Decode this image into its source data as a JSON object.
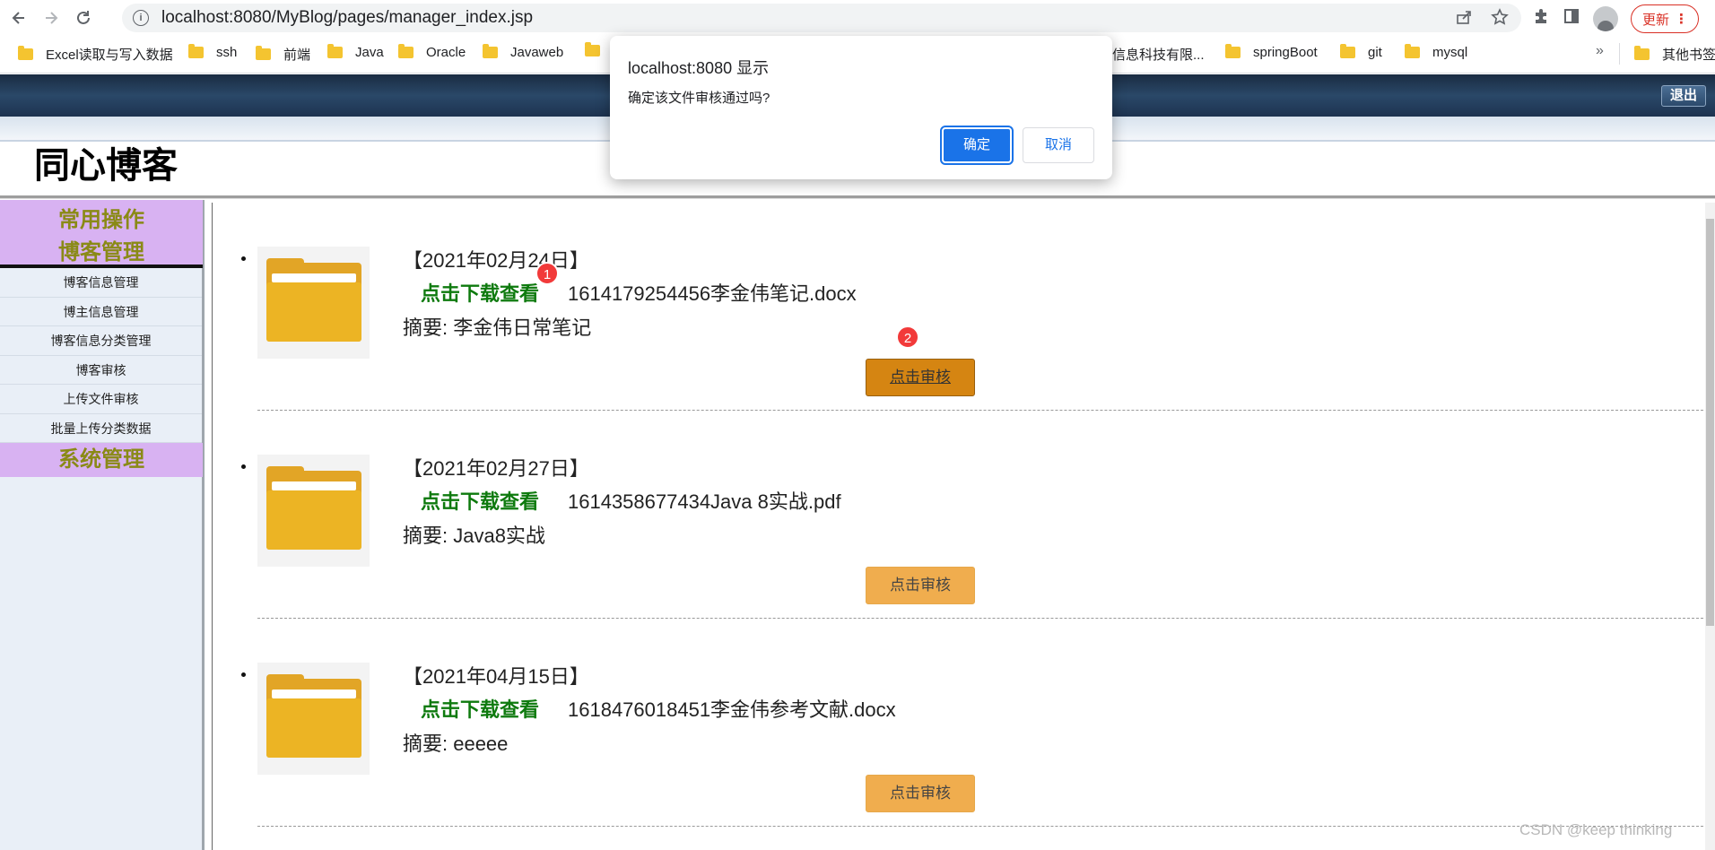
{
  "browser": {
    "url": "localhost:8080/MyBlog/pages/manager_index.jsp",
    "update_label": "更新",
    "more_bookmarks": "»",
    "bookmarks": [
      "Excel读取与写入数据",
      "ssh",
      "前端",
      "Java",
      "Oracle",
      "Javaweb",
      "",
      "信息科技有限...",
      "springBoot",
      "git",
      "mysql"
    ],
    "other_bookmarks": "其他书签"
  },
  "header": {
    "logout_label": "退出",
    "site_title": "同心博客"
  },
  "sidebar": {
    "section1": "常用操作",
    "section2": "博客管理",
    "items": [
      "博客信息管理",
      "博主信息管理",
      "博客信息分类管理",
      "博客审核",
      "上传文件审核",
      "批量上传分类数据"
    ],
    "section3": "系统管理"
  },
  "entries": [
    {
      "date": "【2021年02月24日】",
      "download_label": "点击下载查看",
      "filename": "1614179254456李金伟笔记.docx",
      "summary": "摘要: 李金伟日常笔记",
      "review_label": "点击审核"
    },
    {
      "date": "【2021年02月27日】",
      "download_label": "点击下载查看",
      "filename": "1614358677434Java 8实战.pdf",
      "summary": "摘要: Java8实战",
      "review_label": "点击审核"
    },
    {
      "date": "【2021年04月15日】",
      "download_label": "点击下载查看",
      "filename": "1618476018451李金伟参考文献.docx",
      "summary": "摘要: eeeee",
      "review_label": "点击审核"
    }
  ],
  "annotations": {
    "badge1": "1",
    "badge2": "2"
  },
  "dialog": {
    "title": "localhost:8080 显示",
    "message": "确定该文件审核通过吗?",
    "ok_label": "确定",
    "cancel_label": "取消"
  },
  "watermark": "CSDN @keep   thinking",
  "colors": {
    "header_dark": "#1a2c42",
    "sidebar_head": "#d8b2f2",
    "sidebar_head_text": "#8a8a16",
    "link_green": "#0e7a0e",
    "review_button": "#f0ad4e",
    "review_button_active": "#d58512",
    "dialog_primary": "#1a73e8",
    "badge_red": "#f23a3a"
  }
}
